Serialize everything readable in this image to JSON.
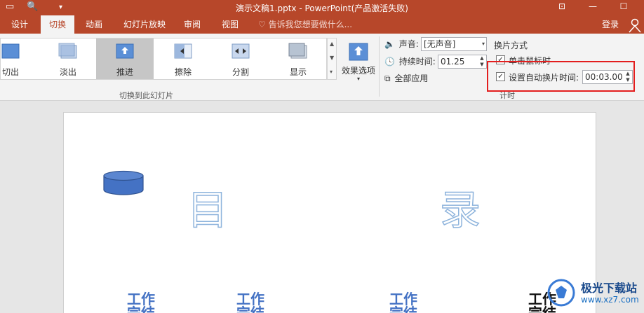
{
  "window": {
    "title": "演示文稿1.pptx - PowerPoint(产品激活失败)",
    "restore_icon": "ribbon-display-options-icon",
    "minimize_symbol": "—"
  },
  "tabs": [
    {
      "label": "设计"
    },
    {
      "label": "切换",
      "active": true
    },
    {
      "label": "动画"
    },
    {
      "label": "幻灯片放映"
    },
    {
      "label": "审阅"
    },
    {
      "label": "视图"
    }
  ],
  "tell_me": "告诉我您想要做什么...",
  "login": "登录",
  "transitions": [
    {
      "label": "切出",
      "icon": "cut-transition-icon"
    },
    {
      "label": "淡出",
      "icon": "fade-transition-icon"
    },
    {
      "label": "推进",
      "icon": "push-transition-icon",
      "selected": true
    },
    {
      "label": "擦除",
      "icon": "wipe-transition-icon"
    },
    {
      "label": "分割",
      "icon": "split-transition-icon"
    },
    {
      "label": "显示",
      "icon": "reveal-transition-icon"
    }
  ],
  "effect_options": "效果选项",
  "group_transition": "切换到此幻灯片",
  "timing": {
    "sound_label": "声音:",
    "sound_value": "[无声音]",
    "duration_label": "持续时间:",
    "duration_value": "01.25",
    "apply_all": "全部应用",
    "advance_title": "换片方式",
    "on_click": "单击鼠标时",
    "on_click_checked": true,
    "auto_label": "设置自动换片时间:",
    "auto_checked": true,
    "auto_value": "00:03.00",
    "group_label": "计时"
  },
  "slide": {
    "char1": "目",
    "char2": "录",
    "items": [
      "工作\n完结",
      "工作\n完结",
      "工作\n完结",
      "工作\n完结"
    ]
  },
  "watermark": {
    "name": "极光下载站",
    "url": "www.xz7.com"
  },
  "colors": {
    "accent": "#b7472a",
    "highlight": "#e31e1e",
    "shape": "#4472c4"
  }
}
